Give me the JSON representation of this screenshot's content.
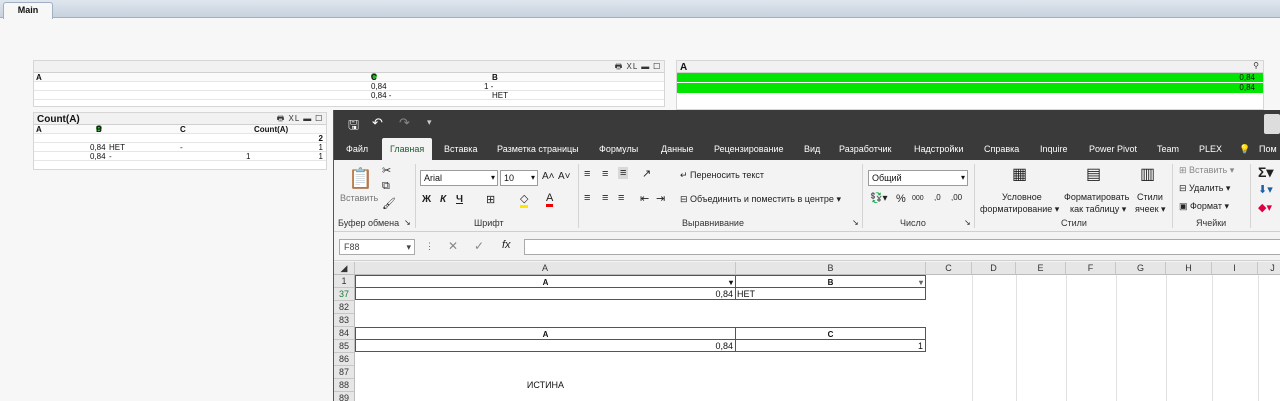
{
  "tabs": {
    "main": "Main"
  },
  "qlik_table1": {
    "icons": "🖶 XL ▬ ☐",
    "col_a": "A",
    "col_c": "C",
    "col_b": "B",
    "rows": [
      {
        "c": "0,84",
        "b": "1 -"
      },
      {
        "c": "0,84 -",
        "b": "НЕТ"
      }
    ]
  },
  "qlik_listbox": {
    "title": "A",
    "search_icon": "⚲",
    "values": [
      "0,84",
      "0,84"
    ],
    "selected_color": "#00e600"
  },
  "qlik_count": {
    "title": "Count(A)",
    "icons": "🖶 XL ▬ ☐",
    "headers": {
      "a": "A",
      "b": "B",
      "c": "C",
      "count": "Count(A)"
    },
    "total": "2",
    "rows": [
      {
        "a": "0,84",
        "b": "НЕТ",
        "c": "-",
        "count": "1"
      },
      {
        "a": "0,84",
        "b": "-",
        "c": "1",
        "count": "1"
      }
    ]
  },
  "excel": {
    "menu": [
      "Файл",
      "Главная",
      "Вставка",
      "Разметка страницы",
      "Формулы",
      "Данные",
      "Рецензирование",
      "Вид",
      "Разработчик",
      "Надстройки",
      "Справка",
      "Inquire",
      "Power Pivot",
      "Team",
      "PLEX",
      "Пом"
    ],
    "ribbon": {
      "paste": "Вставить",
      "clipboard": "Буфер обмена",
      "font_name": "Arial",
      "font_size": "10",
      "font": "Шрифт",
      "wrap": "Переносить текст",
      "merge": "Объединить и поместить в центре",
      "alignment": "Выравнивание",
      "number_format": "Общий",
      "number": "Число",
      "cond_format_1": "Условное",
      "cond_format_2": "форматирование",
      "table_format_1": "Форматировать",
      "table_format_2": "как таблицу",
      "styles_btn_1": "Стили",
      "styles_btn_2": "ячеек",
      "styles": "Стили",
      "insert": "Вставить",
      "delete": "Удалить",
      "format": "Формат",
      "cells": "Ячейки"
    },
    "name_box": "F88",
    "columns": [
      "A",
      "B",
      "C",
      "D",
      "E",
      "F",
      "G",
      "H",
      "I",
      "J"
    ],
    "rows": [
      {
        "num": "1",
        "a": "A",
        "b": "B"
      },
      {
        "num": "37",
        "a": "0,84",
        "b": "НЕТ"
      },
      {
        "num": "82",
        "a": "",
        "b": ""
      },
      {
        "num": "83",
        "a": "",
        "b": ""
      },
      {
        "num": "84",
        "a": "A",
        "b": "C"
      },
      {
        "num": "85",
        "a": "0,84",
        "b": "1"
      },
      {
        "num": "86",
        "a": "",
        "b": ""
      },
      {
        "num": "87",
        "a": "",
        "b": ""
      },
      {
        "num": "88",
        "a": "ИСТИНА",
        "b": ""
      }
    ]
  }
}
